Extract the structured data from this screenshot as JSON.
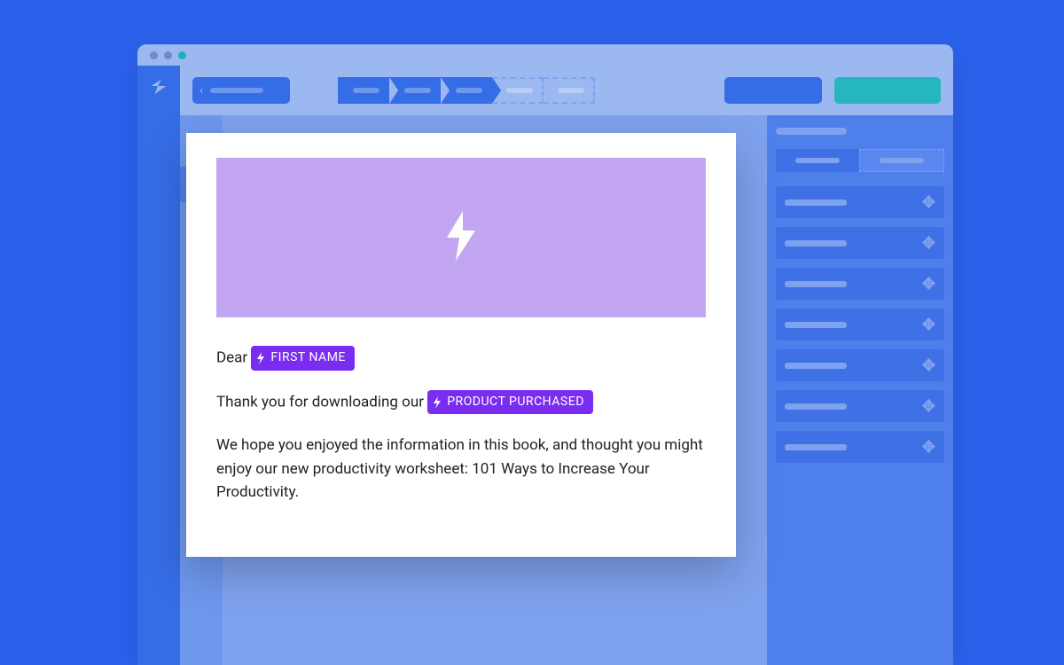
{
  "email": {
    "greeting_prefix": "Dear",
    "tag_first_name": "FIRST NAME",
    "line2_prefix": "Thank you for downloading our",
    "tag_product": "PRODUCT PURCHASED",
    "body": "We hope you enjoyed the information in this book, and thought you might enjoy our new productivity worksheet: 101 Ways to Increase Your Productivity."
  },
  "colors": {
    "accent_purple": "#7a2cf0",
    "hero_purple": "#c3a6f2",
    "brand_blue": "#356de6",
    "teal": "#26b6c0"
  }
}
